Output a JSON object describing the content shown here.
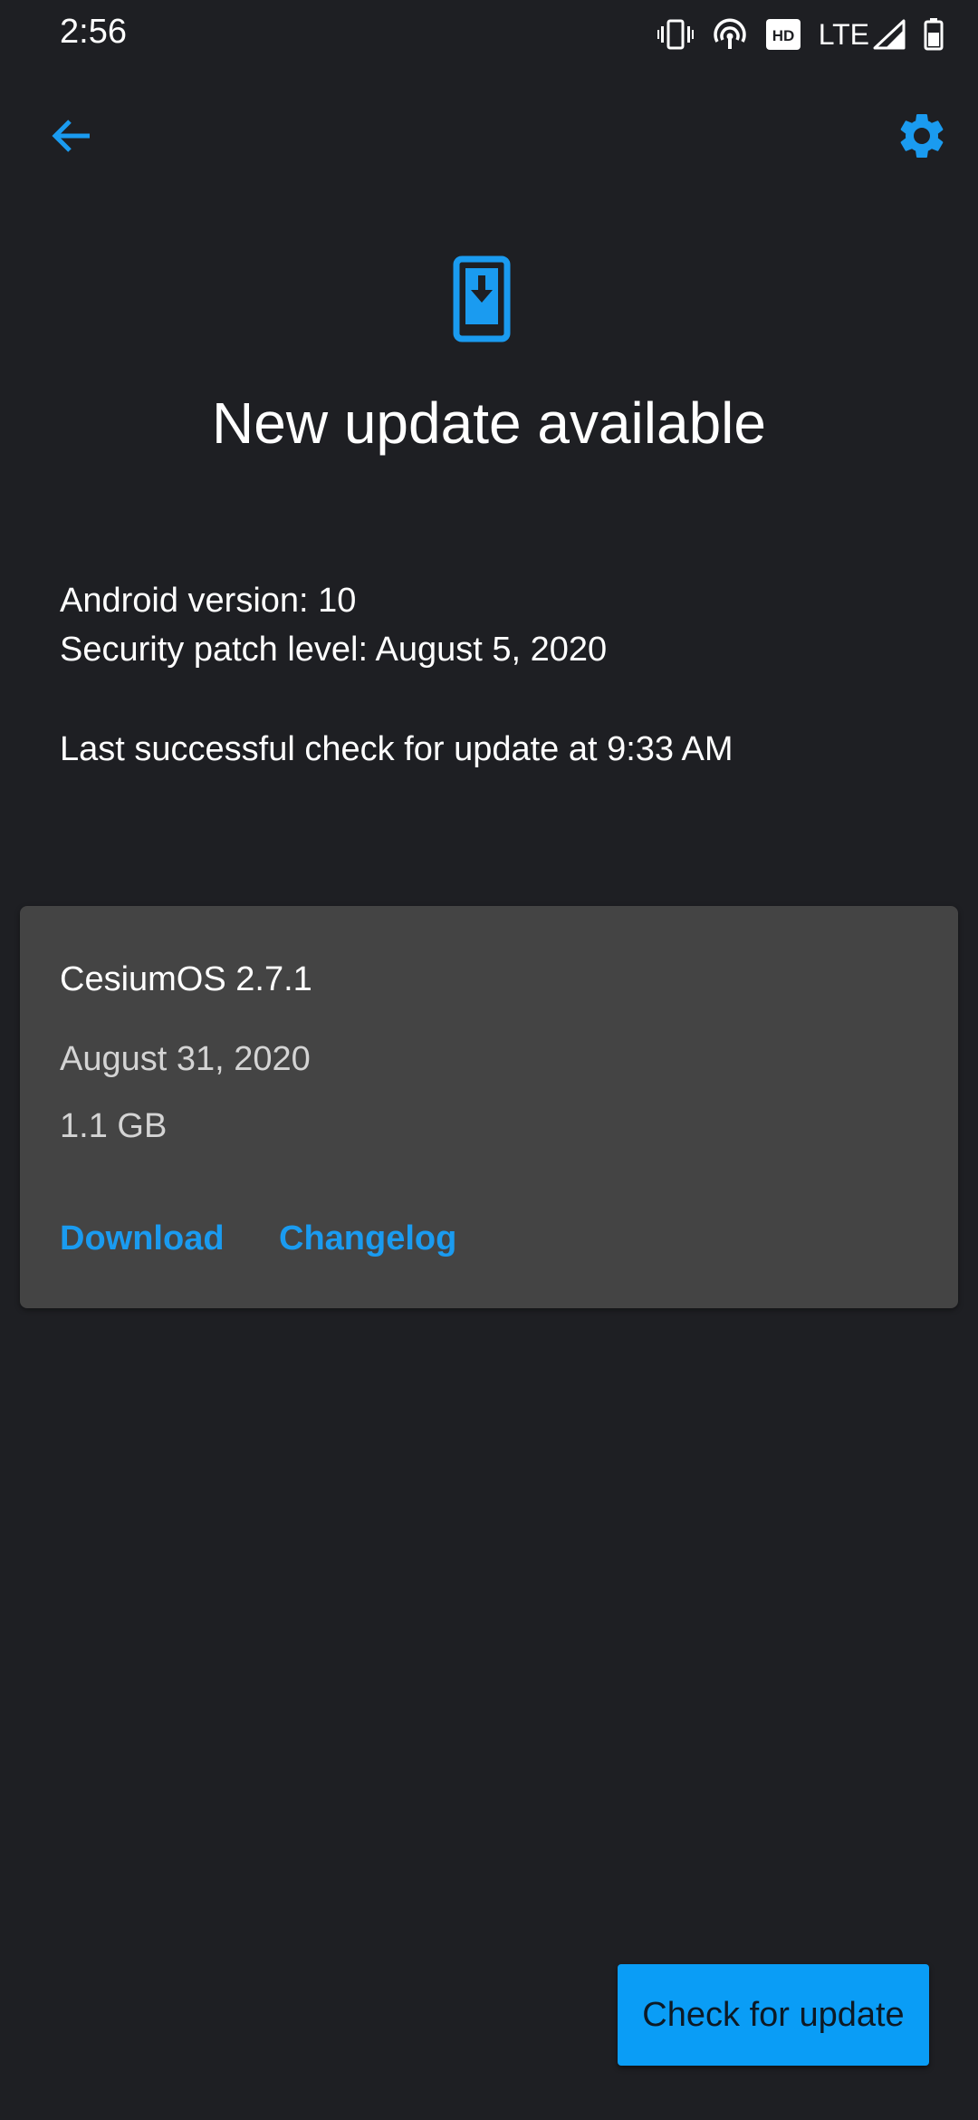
{
  "status_bar": {
    "time": "2:56",
    "network_label": "LTE",
    "hd_badge": "HD",
    "icons": [
      "vibrate-icon",
      "hotspot-icon",
      "hd-badge-icon",
      "signal-icon",
      "battery-icon"
    ]
  },
  "toolbar": {
    "back_icon": "arrow-back-icon",
    "settings_icon": "gear-icon"
  },
  "hero": {
    "icon": "phone-download-icon",
    "title": "New update available"
  },
  "info": {
    "android_version": "Android version: 10",
    "security_patch": "Security patch level: August 5, 2020",
    "last_check": "Last successful check for update at 9:33 AM"
  },
  "update_card": {
    "title": "CesiumOS 2.7.1",
    "date": "August 31, 2020",
    "size": "1.1 GB",
    "download_label": "Download",
    "changelog_label": "Changelog"
  },
  "actions": {
    "check_label": "Check for update"
  },
  "colors": {
    "background": "#1e1f23",
    "card": "#444444",
    "accent": "#1a9bf0",
    "button": "#0a9df6"
  }
}
